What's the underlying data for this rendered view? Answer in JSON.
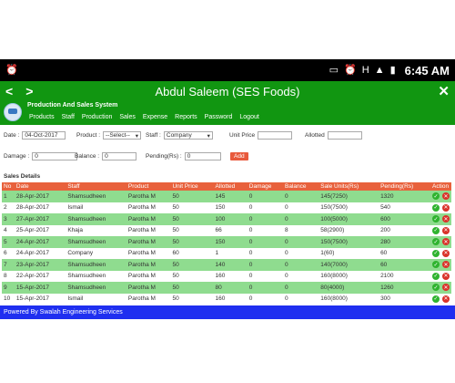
{
  "status_bar": {
    "time": "6:45 AM",
    "h_label": "H"
  },
  "app_bar": {
    "title": "Abdul Saleem (SES Foods)"
  },
  "header": {
    "system_name": "Production And Sales System",
    "menu": [
      "Products",
      "Staff",
      "Production",
      "Sales",
      "Expense",
      "Reports",
      "Password",
      "Logout"
    ]
  },
  "form": {
    "date_label": "Date :",
    "date_value": "04-Oct-2017",
    "product_label": "Product :",
    "product_value": "--Select--",
    "staff_label": "Staff :",
    "staff_value": "Company",
    "unit_price_label": "Unit Price",
    "allotted_label": "Allotted",
    "damage_label": "Damage :",
    "damage_value": "0",
    "balance_label": "Balance :",
    "balance_value": "0",
    "pending_label": "Pending(Rs) :",
    "pending_value": "0",
    "add_label": "Add"
  },
  "sales_details": {
    "title": "Sales Details",
    "columns": [
      "No",
      "Date",
      "Staff",
      "Product",
      "Unit Price",
      "Allotted",
      "Damage",
      "Balance",
      "Sale Units(Rs)",
      "Pending(Rs)",
      "Action"
    ],
    "rows": [
      {
        "no": "1",
        "date": "28-Apr-2017",
        "staff": "Shamsudheen",
        "product": "Parotha M",
        "unit_price": "50",
        "allotted": "145",
        "damage": "0",
        "balance": "0",
        "sale_units": "145(7250)",
        "pending": "1320"
      },
      {
        "no": "2",
        "date": "28-Apr-2017",
        "staff": "Ismail",
        "product": "Parotha M",
        "unit_price": "50",
        "allotted": "150",
        "damage": "0",
        "balance": "0",
        "sale_units": "150(7500)",
        "pending": "540"
      },
      {
        "no": "3",
        "date": "27-Apr-2017",
        "staff": "Shamsudheen",
        "product": "Parotha M",
        "unit_price": "50",
        "allotted": "100",
        "damage": "0",
        "balance": "0",
        "sale_units": "100(5000)",
        "pending": "600"
      },
      {
        "no": "4",
        "date": "25-Apr-2017",
        "staff": "Khaja",
        "product": "Parotha M",
        "unit_price": "50",
        "allotted": "66",
        "damage": "0",
        "balance": "8",
        "sale_units": "58(2900)",
        "pending": "200"
      },
      {
        "no": "5",
        "date": "24-Apr-2017",
        "staff": "Shamsudheen",
        "product": "Parotha M",
        "unit_price": "50",
        "allotted": "150",
        "damage": "0",
        "balance": "0",
        "sale_units": "150(7500)",
        "pending": "280"
      },
      {
        "no": "6",
        "date": "24-Apr-2017",
        "staff": "Company",
        "product": "Parotha M",
        "unit_price": "60",
        "allotted": "1",
        "damage": "0",
        "balance": "0",
        "sale_units": "1(60)",
        "pending": "60"
      },
      {
        "no": "7",
        "date": "23-Apr-2017",
        "staff": "Shamsudheen",
        "product": "Parotha M",
        "unit_price": "50",
        "allotted": "140",
        "damage": "0",
        "balance": "0",
        "sale_units": "140(7000)",
        "pending": "60"
      },
      {
        "no": "8",
        "date": "22-Apr-2017",
        "staff": "Shamsudheen",
        "product": "Parotha M",
        "unit_price": "50",
        "allotted": "160",
        "damage": "0",
        "balance": "0",
        "sale_units": "160(8000)",
        "pending": "2100"
      },
      {
        "no": "9",
        "date": "15-Apr-2017",
        "staff": "Shamsudheen",
        "product": "Parotha M",
        "unit_price": "50",
        "allotted": "80",
        "damage": "0",
        "balance": "0",
        "sale_units": "80(4000)",
        "pending": "1260"
      },
      {
        "no": "10",
        "date": "15-Apr-2017",
        "staff": "Ismail",
        "product": "Parotha M",
        "unit_price": "50",
        "allotted": "160",
        "damage": "0",
        "balance": "0",
        "sale_units": "160(8000)",
        "pending": "300"
      }
    ]
  },
  "footer": {
    "text": "Powered By Swalah Engineering Services"
  },
  "colors": {
    "header_green": "#119611",
    "table_header": "#e8613c",
    "row_green": "#8fdc8f",
    "footer_blue": "#1f2ff0",
    "add_button": "#e85a3c"
  },
  "icons": [
    "alarm-icon",
    "cast-icon",
    "alarm-icon",
    "signal-icon",
    "battery-icon",
    "back-arrow-icon",
    "forward-arrow-icon",
    "close-icon",
    "logo-icon",
    "approve-icon",
    "delete-icon"
  ]
}
